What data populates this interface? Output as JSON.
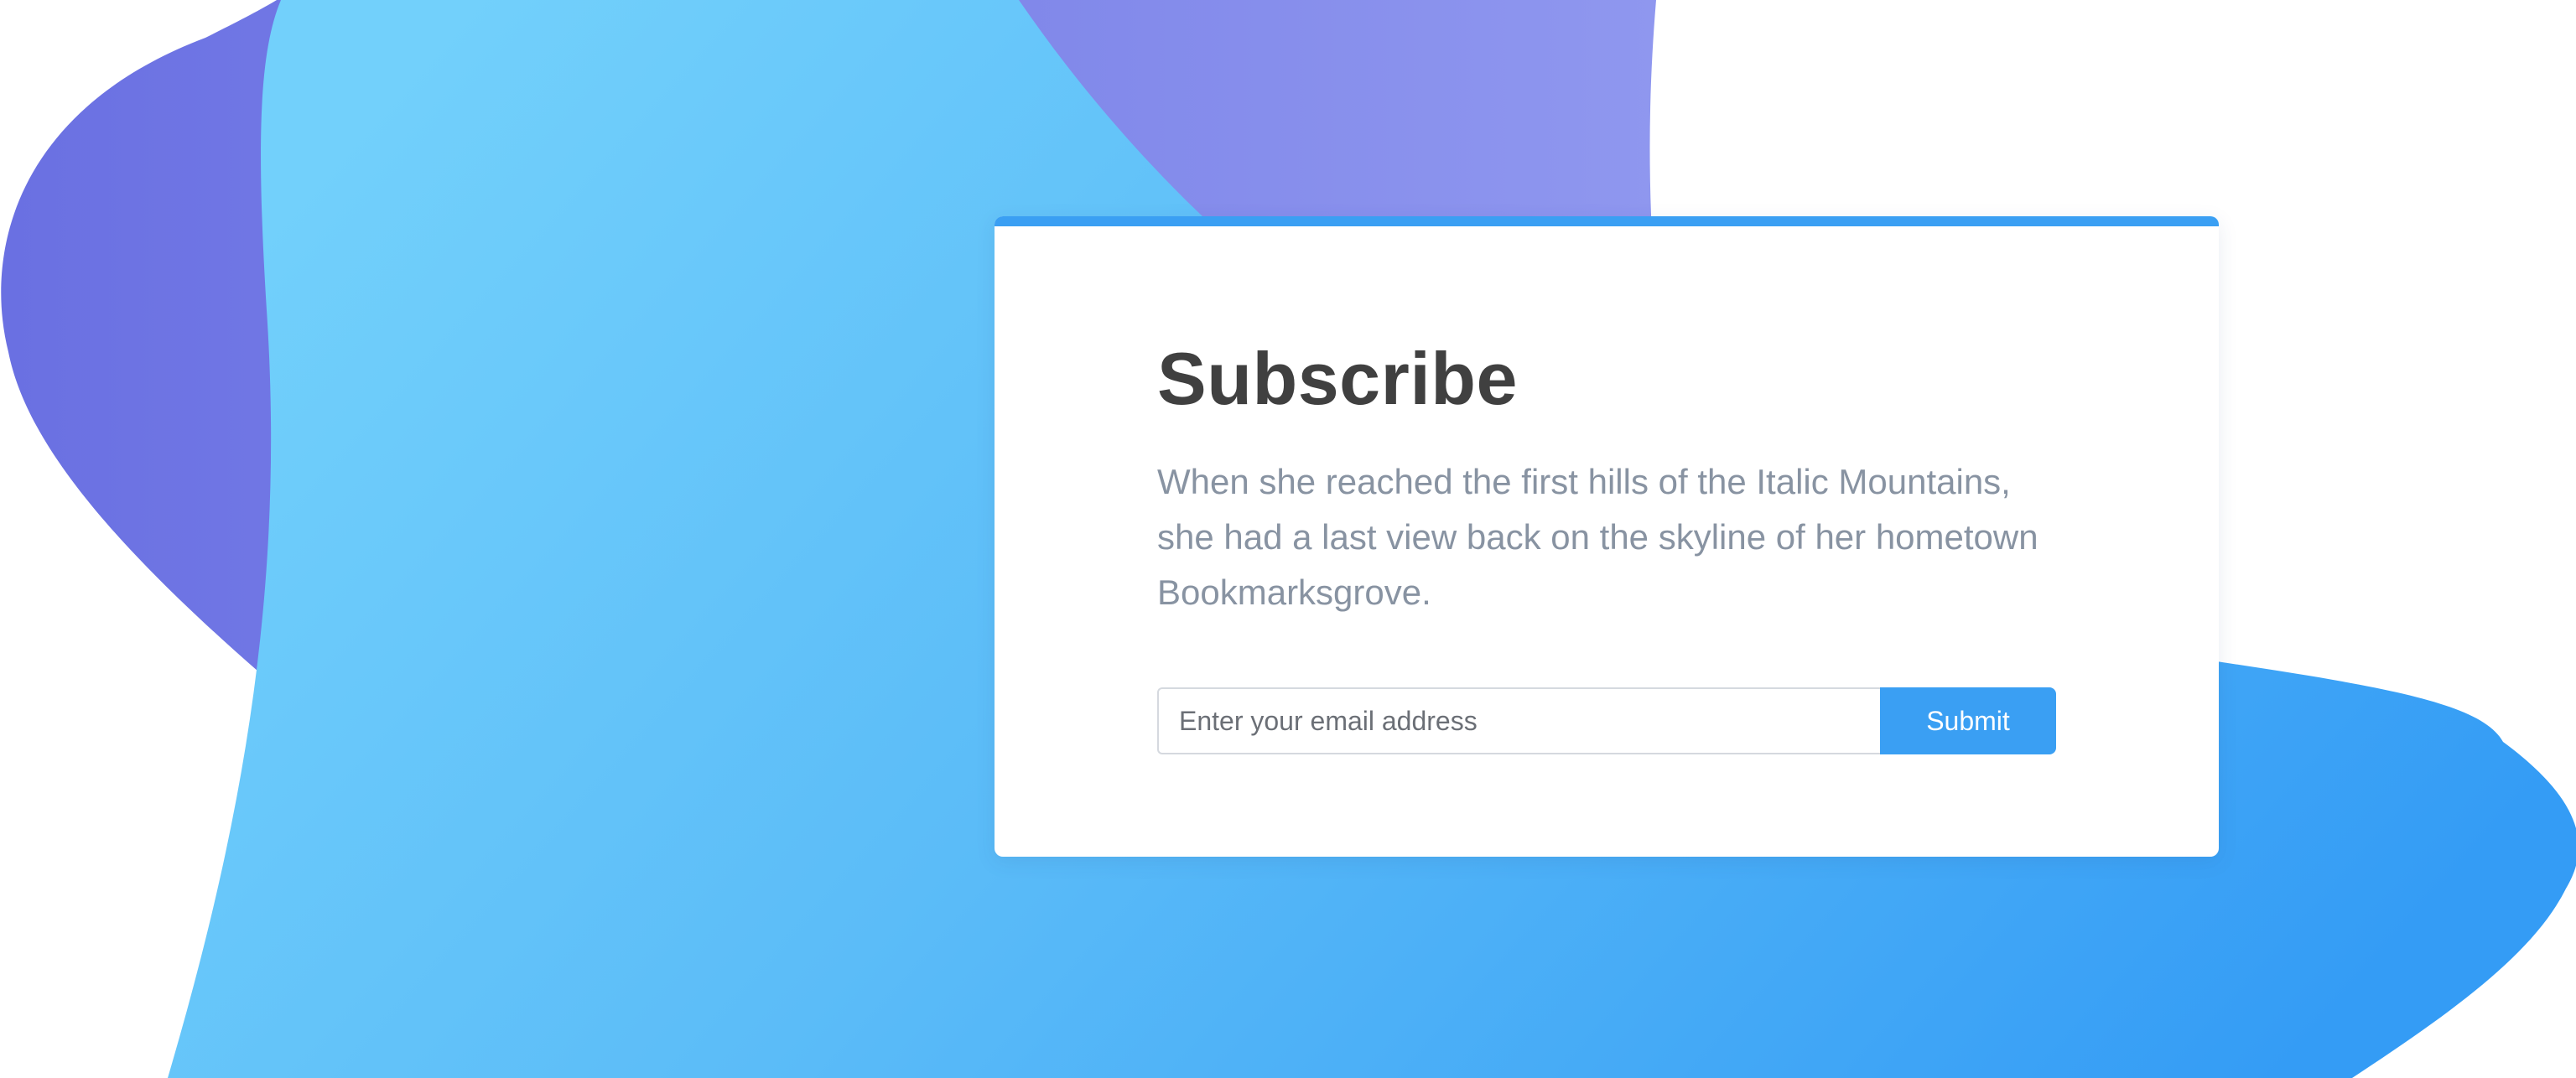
{
  "subscribe": {
    "title": "Subscribe",
    "description": "When she reached the first hills of the Italic Mountains, she had a last view back on the skyline of her hometown Bookmarksgrove.",
    "email_placeholder": "Enter your email address",
    "submit_label": "Submit"
  },
  "colors": {
    "accent": "#3a9ff3",
    "title": "#404040",
    "description": "#8893a2",
    "blob_purple": "#6a70e2",
    "blob_light_blue": "#72d0fb",
    "blob_blue": "#349cf5"
  }
}
